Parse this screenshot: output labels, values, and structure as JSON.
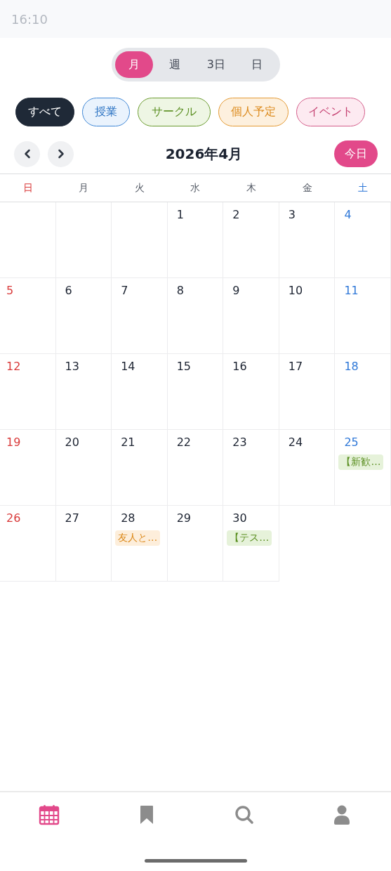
{
  "status_bar": {
    "time": "16:10"
  },
  "view_switch": [
    {
      "label": "月",
      "selected": true
    },
    {
      "label": "週",
      "selected": false
    },
    {
      "label": "3日",
      "selected": false
    },
    {
      "label": "日",
      "selected": false
    }
  ],
  "filters": [
    {
      "label": "すべて",
      "kind": "all",
      "selected": true
    },
    {
      "label": "授業",
      "kind": "class",
      "selected": false
    },
    {
      "label": "サークル",
      "kind": "circle",
      "selected": false
    },
    {
      "label": "個人予定",
      "kind": "personal",
      "selected": false
    },
    {
      "label": "イベント",
      "kind": "event",
      "selected": false
    }
  ],
  "month_nav": {
    "title": "2026年4月",
    "today_button": "今日"
  },
  "weekdays": [
    "日",
    "月",
    "火",
    "水",
    "木",
    "金",
    "土"
  ],
  "weeks": [
    [
      {
        "kind": "empty"
      },
      {
        "kind": "empty"
      },
      {
        "kind": "empty"
      },
      {
        "kind": "day",
        "day": "1"
      },
      {
        "kind": "day",
        "day": "2"
      },
      {
        "kind": "day",
        "day": "3"
      },
      {
        "kind": "day",
        "day": "4"
      }
    ],
    [
      {
        "kind": "day",
        "day": "5"
      },
      {
        "kind": "day",
        "day": "6"
      },
      {
        "kind": "day",
        "day": "7"
      },
      {
        "kind": "day",
        "day": "8"
      },
      {
        "kind": "day",
        "day": "9"
      },
      {
        "kind": "day",
        "day": "10"
      },
      {
        "kind": "day",
        "day": "11"
      }
    ],
    [
      {
        "kind": "day",
        "day": "12"
      },
      {
        "kind": "day",
        "day": "13"
      },
      {
        "kind": "day",
        "day": "14"
      },
      {
        "kind": "day",
        "day": "15"
      },
      {
        "kind": "day",
        "day": "16"
      },
      {
        "kind": "day",
        "day": "17"
      },
      {
        "kind": "day",
        "day": "18"
      }
    ],
    [
      {
        "kind": "day",
        "day": "19"
      },
      {
        "kind": "day",
        "day": "20"
      },
      {
        "kind": "day",
        "day": "21"
      },
      {
        "kind": "day",
        "day": "22"
      },
      {
        "kind": "day",
        "day": "23"
      },
      {
        "kind": "day",
        "day": "24"
      },
      {
        "kind": "day",
        "day": "25",
        "events": [
          {
            "label": "【新歓…",
            "kind": "circle"
          }
        ]
      }
    ],
    [
      {
        "kind": "day",
        "day": "26"
      },
      {
        "kind": "day",
        "day": "27"
      },
      {
        "kind": "day",
        "day": "28",
        "events": [
          {
            "label": "友人と…",
            "kind": "personal"
          }
        ]
      },
      {
        "kind": "day",
        "day": "29"
      },
      {
        "kind": "day",
        "day": "30",
        "events": [
          {
            "label": "【テス…",
            "kind": "circle"
          }
        ]
      }
    ]
  ],
  "bottom_nav": [
    {
      "kind": "calendar",
      "selected": true
    },
    {
      "kind": "bookmark",
      "selected": false
    },
    {
      "kind": "search",
      "selected": false
    },
    {
      "kind": "profile",
      "selected": false
    }
  ]
}
